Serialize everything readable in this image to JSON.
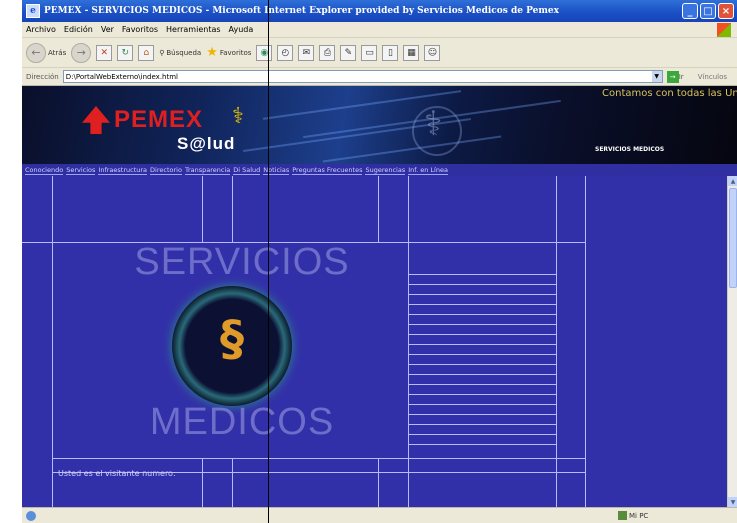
{
  "window": {
    "title": "PEMEX - SERVICIOS MEDICOS - Microsoft Internet Explorer provided by Servicios Medicos de Pemex",
    "minimize": "_",
    "maximize": "□",
    "close": "×"
  },
  "menubar": {
    "items": [
      "Archivo",
      "Edición",
      "Ver",
      "Favoritos",
      "Herramientas",
      "Ayuda"
    ]
  },
  "toolbar": {
    "back_label": "Atrás",
    "search_label": "Búsqueda",
    "favorites_label": "Favoritos"
  },
  "address": {
    "label": "Dirección",
    "value": "D:\\PortalWebExterno\\index.html",
    "go_label": "Ir",
    "links_label": "Vínculos"
  },
  "banner": {
    "logo_text": "PEMEX",
    "salud_text": "S@lud",
    "ticker": "Contamos con todas las Uni",
    "section_label": "SERVICIOS MEDICOS"
  },
  "nav": {
    "items": [
      "Conociendo",
      "Servicios",
      "Infraestructura",
      "Directorio",
      "Transparencia",
      "Di Salud",
      "Noticias",
      "Preguntas Frecuentes",
      "Sugerencias",
      "Inf. en Línea"
    ]
  },
  "hero": {
    "top": "SERVICIOS",
    "bottom": "MEDICOS"
  },
  "footer": {
    "visitor_label": "Usted es el visitante numero:"
  },
  "statusbar": {
    "zone": "Mi PC"
  },
  "colors": {
    "page_bg": "#3230a8",
    "nav_bg": "#302fa2",
    "grid_line": "#b9b9ff",
    "titlebar": "#1a4fc4"
  }
}
